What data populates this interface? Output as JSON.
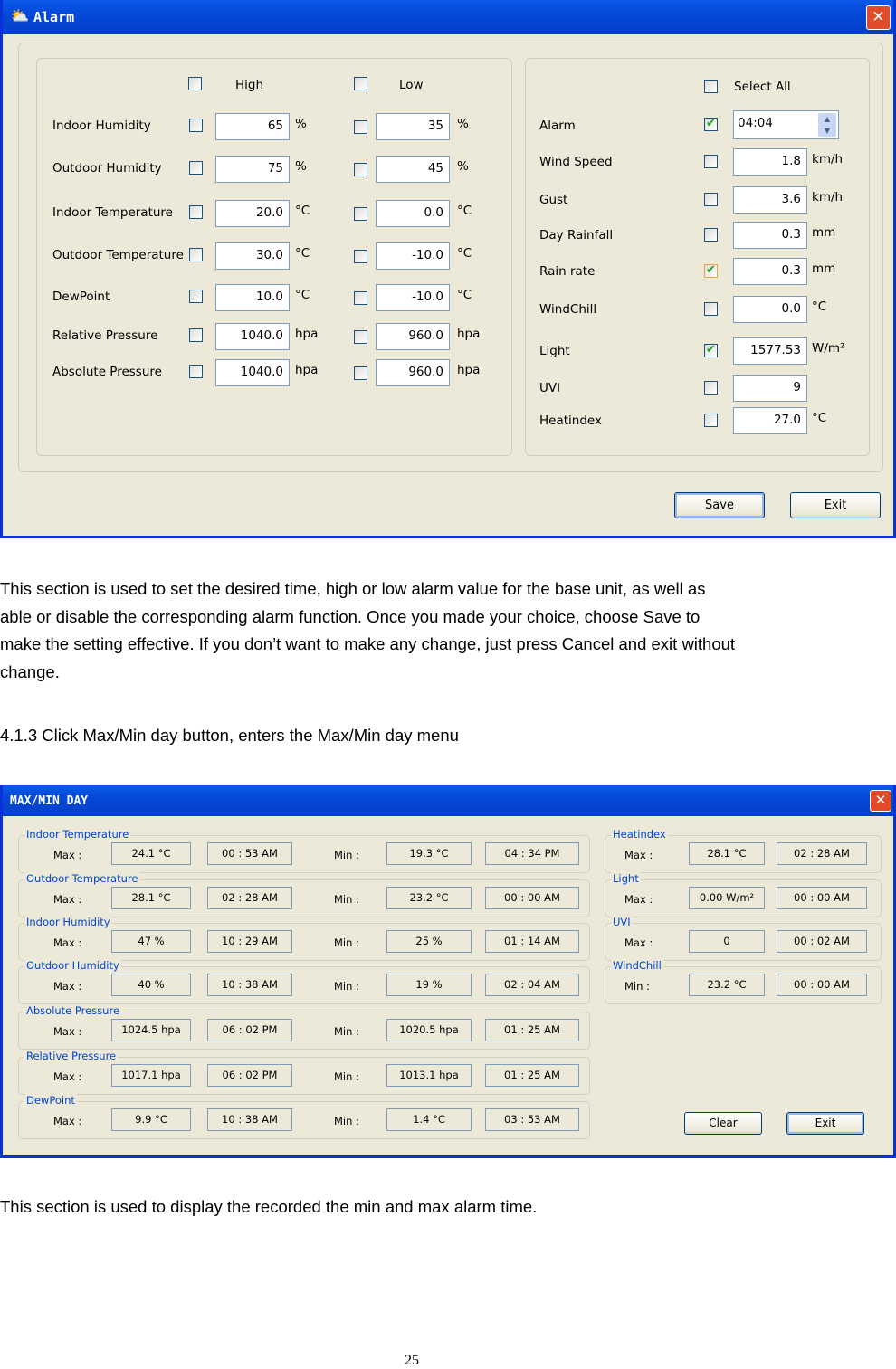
{
  "alarm_window": {
    "title": "Alarm",
    "high_label": "High",
    "low_label": "Low",
    "select_all_label": "Select All",
    "left_rows": [
      {
        "label": "Indoor Humidity",
        "high": "65",
        "high_unit": "%",
        "low": "35",
        "low_unit": "%"
      },
      {
        "label": "Outdoor Humidity",
        "high": "75",
        "high_unit": "%",
        "low": "45",
        "low_unit": "%"
      },
      {
        "label": "Indoor Temperature",
        "high": "20.0",
        "high_unit": "°C",
        "low": "0.0",
        "low_unit": "°C"
      },
      {
        "label": "Outdoor Temperature",
        "high": "30.0",
        "high_unit": "°C",
        "low": "-10.0",
        "low_unit": "°C"
      },
      {
        "label": "DewPoint",
        "high": "10.0",
        "high_unit": "°C",
        "low": "-10.0",
        "low_unit": "°C"
      },
      {
        "label": "Relative Pressure",
        "high": "1040.0",
        "high_unit": "hpa",
        "low": "960.0",
        "low_unit": "hpa"
      },
      {
        "label": "Absolute Pressure",
        "high": "1040.0",
        "high_unit": "hpa",
        "low": "960.0",
        "low_unit": "hpa"
      }
    ],
    "alarm_time": {
      "label": "Alarm",
      "value": "04:04",
      "checked": true
    },
    "right_rows": [
      {
        "label": "Wind Speed",
        "value": "1.8",
        "unit": "km/h",
        "checked": false
      },
      {
        "label": "Gust",
        "value": "3.6",
        "unit": "km/h",
        "checked": false
      },
      {
        "label": "Day Rainfall",
        "value": "0.3",
        "unit": "mm",
        "checked": false
      },
      {
        "label": "Rain rate",
        "value": "0.3",
        "unit": "mm",
        "checked": true
      },
      {
        "label": "WindChill",
        "value": "0.0",
        "unit": "°C",
        "checked": false
      },
      {
        "label": "Light",
        "value": "1577.53",
        "unit": "W/m²",
        "checked": true
      },
      {
        "label": "UVI",
        "value": "9",
        "unit": "",
        "checked": false
      },
      {
        "label": "Heatindex",
        "value": "27.0",
        "unit": "°C",
        "checked": false
      }
    ],
    "save_label": "Save",
    "exit_label": "Exit"
  },
  "text": {
    "para1_lines": [
      "This section is used to set the desired time, high or low alarm value for the base unit, as well as",
      "able or disable the corresponding alarm function. Once you made your choice, choose Save to",
      "make the setting effective. If you don’t want to make any change, just press Cancel and exit without",
      "change."
    ],
    "heading": "4.1.3 Click Max/Min day button, enters the Max/Min day menu",
    "para2": "This section is used to display the recorded the min and max alarm time.",
    "page_number": "25"
  },
  "maxmin_window": {
    "title": "MAX/MIN DAY",
    "max_label": "Max :",
    "min_label": "Min :",
    "left_groups": [
      {
        "title": "Indoor Temperature",
        "max": "24.1 °C",
        "max_time": "00 : 53 AM",
        "min": "19.3 °C",
        "min_time": "04 : 34 PM"
      },
      {
        "title": "Outdoor Temperature",
        "max": "28.1 °C",
        "max_time": "02 : 28 AM",
        "min": "23.2 °C",
        "min_time": "00 : 00 AM"
      },
      {
        "title": "Indoor Humidity",
        "max": "47 %",
        "max_time": "10 : 29 AM",
        "min": "25 %",
        "min_time": "01 : 14 AM"
      },
      {
        "title": "Outdoor Humidity",
        "max": "40 %",
        "max_time": "10 : 38 AM",
        "min": "19 %",
        "min_time": "02 : 04 AM"
      },
      {
        "title": "Absolute Pressure",
        "max": "1024.5 hpa",
        "max_time": "06 : 02 PM",
        "min": "1020.5 hpa",
        "min_time": "01 : 25 AM"
      },
      {
        "title": "Relative Pressure",
        "max": "1017.1 hpa",
        "max_time": "06 : 02 PM",
        "min": "1013.1 hpa",
        "min_time": "01 : 25 AM"
      },
      {
        "title": "DewPoint",
        "max": "9.9 °C",
        "max_time": "10 : 38 AM",
        "min": "1.4 °C",
        "min_time": "03 : 53 AM"
      }
    ],
    "right_groups": [
      {
        "title": "Heatindex",
        "kind": "Max :",
        "value": "28.1 °C",
        "time": "02 : 28 AM"
      },
      {
        "title": "Light",
        "kind": "Max :",
        "value": "0.00 W/m²",
        "time": "00 : 00 AM"
      },
      {
        "title": "UVI",
        "kind": "Max :",
        "value": "0",
        "time": "00 : 02 AM"
      },
      {
        "title": "WindChill",
        "kind": "Min :",
        "value": "23.2 °C",
        "time": "00 : 00 AM"
      }
    ],
    "clear_label": "Clear",
    "exit_label": "Exit"
  }
}
